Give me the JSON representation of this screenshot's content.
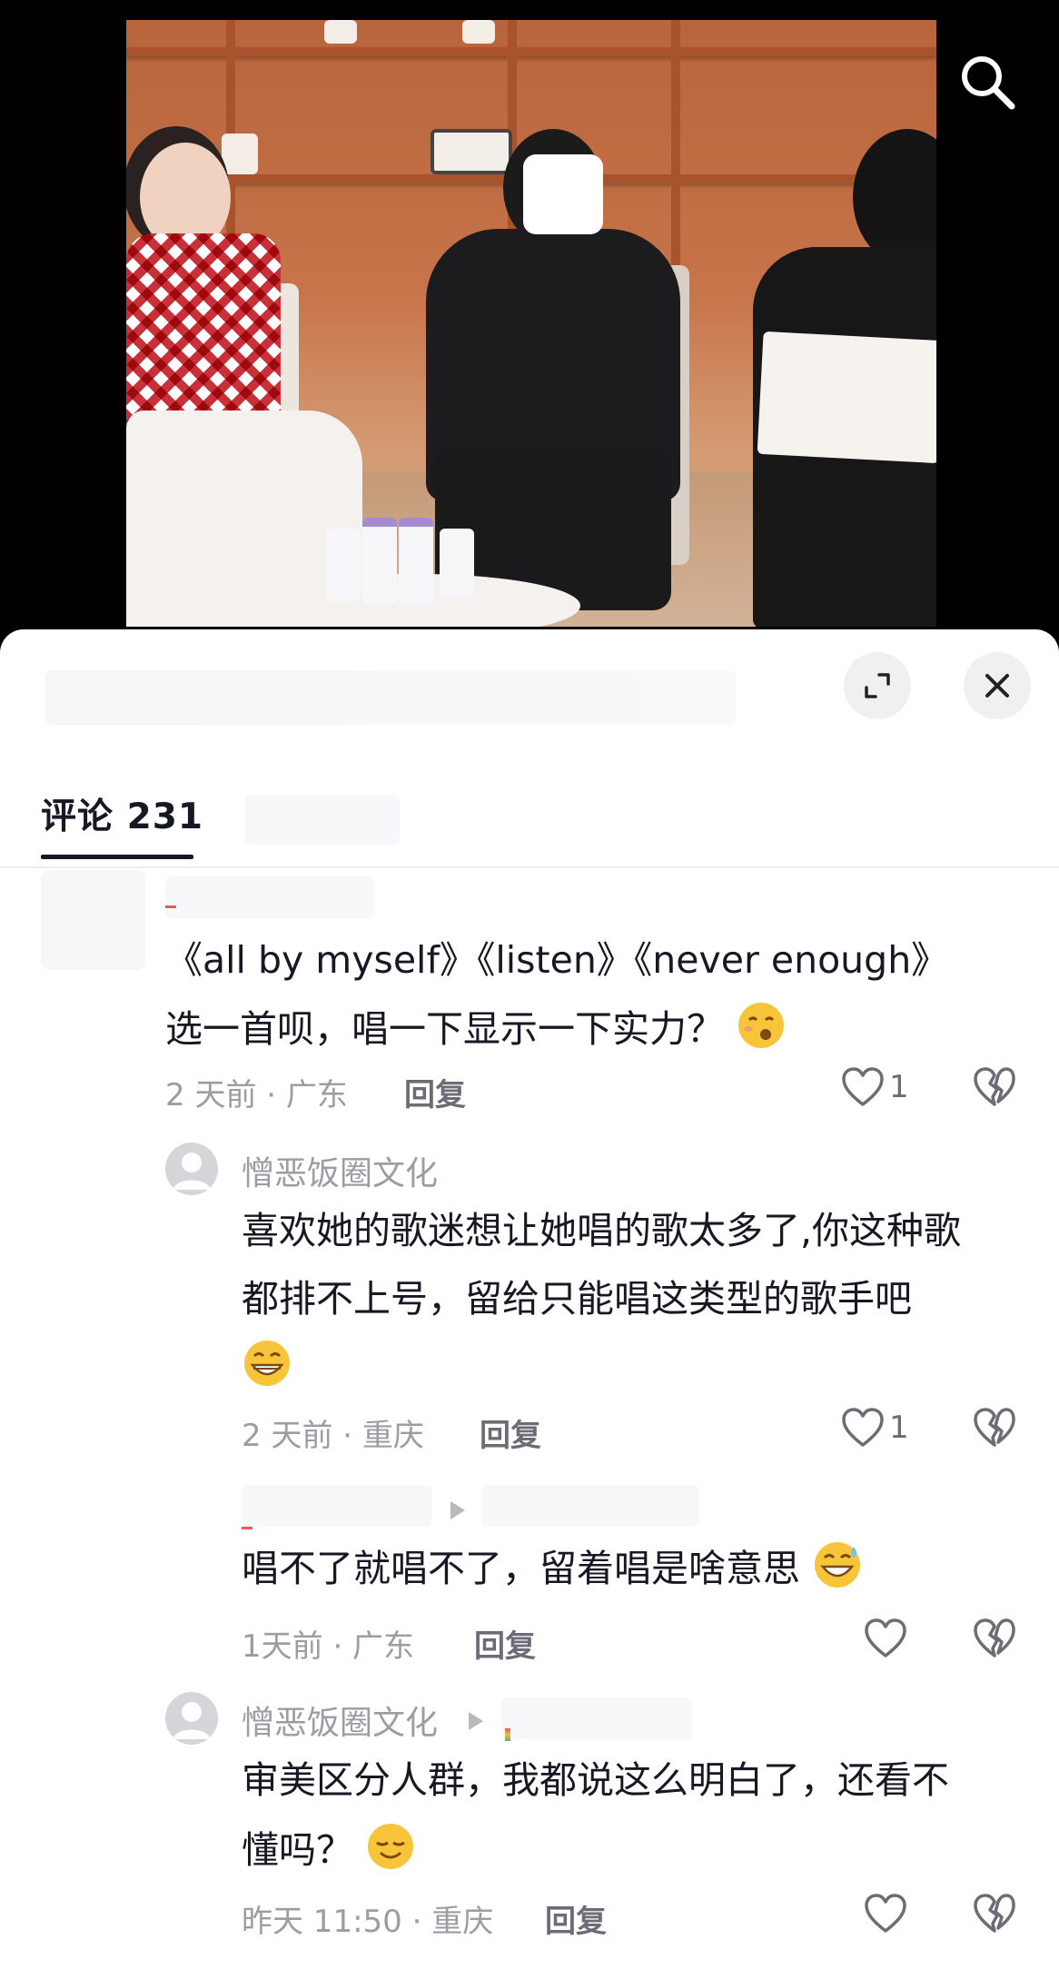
{
  "comments_panel": {
    "tab_label": "评论 231",
    "reply_label": "回复"
  },
  "comments": [
    {
      "line1": "《all by myself》《listen》《never enough》",
      "line2": "选一首呗，唱一下显示一下实力？",
      "emoji": "pleading-face-emoji",
      "meta": "2 天前 · 广东",
      "likes": "1"
    },
    {
      "username": "憎恶饭圈文化",
      "line1": "喜欢她的歌迷想让她唱的歌太多了,你这种歌",
      "line2": "都排不上号，留给只能唱这类型的歌手吧",
      "emoji": "grinning-face-emoji",
      "meta": "2 天前 · 重庆",
      "likes": "1"
    },
    {
      "line1": "唱不了就唱不了，留着唱是啥意思",
      "emoji": "sweat-smile-emoji",
      "meta": "1天前 · 广东",
      "likes": ""
    },
    {
      "username": "憎恶饭圈文化",
      "line1": "审美区分人群，我都说这么明白了，还看不",
      "line2": "懂吗？",
      "emoji": "smirk-face-emoji",
      "meta": "昨天 11:50 · 重庆",
      "likes": ""
    }
  ],
  "icons": {
    "search": "search-icon",
    "expand": "expand-icon",
    "close": "close-icon",
    "like": "heart-icon",
    "dislike": "broken-heart-icon",
    "avatar": "default-avatar-icon"
  },
  "colors": {
    "text_primary": "#161823",
    "text_secondary": "#9c9ca2",
    "sheet_bg": "#ffffff"
  }
}
